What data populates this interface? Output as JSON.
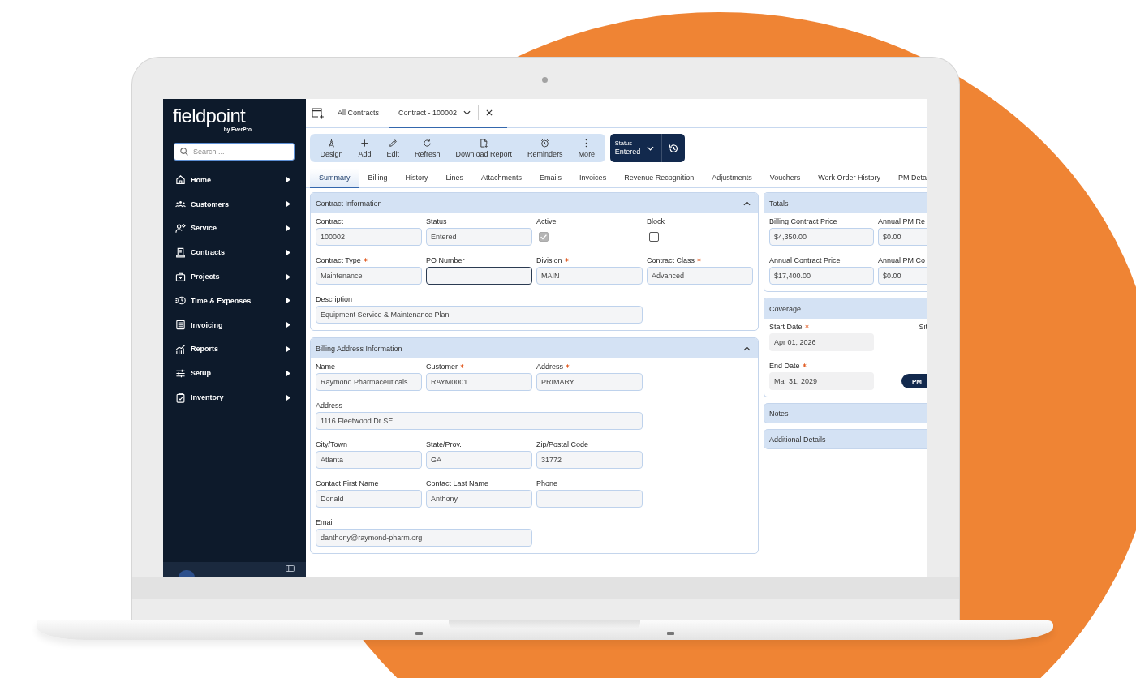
{
  "sidebar": {
    "logo": "fieldpoint",
    "byline": "by EverPro",
    "search": {
      "placeholder": "Search ..."
    },
    "items": [
      {
        "label": "Home"
      },
      {
        "label": "Customers"
      },
      {
        "label": "Service"
      },
      {
        "label": "Contracts"
      },
      {
        "label": "Projects"
      },
      {
        "label": "Time & Expenses"
      },
      {
        "label": "Invoicing"
      },
      {
        "label": "Reports"
      },
      {
        "label": "Setup"
      },
      {
        "label": "Inventory"
      }
    ]
  },
  "page_tabs": [
    {
      "label": "All Contracts",
      "selected": false
    },
    {
      "label": "Contract - 100002",
      "selected": true
    }
  ],
  "toolbar": {
    "actions": [
      {
        "label": "Design"
      },
      {
        "label": "Add"
      },
      {
        "label": "Edit"
      },
      {
        "label": "Refresh"
      },
      {
        "label": "Download Report"
      },
      {
        "label": "Reminders"
      },
      {
        "label": "More"
      }
    ],
    "status": {
      "label": "Status",
      "value": "Entered"
    }
  },
  "tabs": [
    {
      "label": "Summary",
      "selected": true
    },
    {
      "label": "Billing",
      "selected": false
    },
    {
      "label": "History",
      "selected": false
    },
    {
      "label": "Lines",
      "selected": false
    },
    {
      "label": "Attachments",
      "selected": false
    },
    {
      "label": "Emails",
      "selected": false
    },
    {
      "label": "Invoices",
      "selected": false
    },
    {
      "label": "Revenue Recognition",
      "selected": false
    },
    {
      "label": "Adjustments",
      "selected": false
    },
    {
      "label": "Vouchers",
      "selected": false
    },
    {
      "label": "Work Order History",
      "selected": false
    },
    {
      "label": "PM Deta",
      "selected": false
    }
  ],
  "main_sections": [
    {
      "title": "Contract Information",
      "expanded": true,
      "rows": [
        [
          {
            "kind": "text",
            "label": "Contract",
            "value": "100002",
            "required": false,
            "focused": false
          },
          {
            "kind": "text",
            "label": "Status",
            "value": "Entered",
            "required": false,
            "focused": false
          },
          {
            "kind": "checkbox",
            "label": "Active",
            "required": false,
            "checked": true,
            "disabled": true
          },
          {
            "kind": "checkbox",
            "label": "Block",
            "required": false,
            "checked": false,
            "disabled": false
          }
        ],
        [
          {
            "kind": "text",
            "label": "Contract Type",
            "value": "Maintenance",
            "required": true,
            "focused": false
          },
          {
            "kind": "text",
            "label": "PO Number",
            "required": false,
            "focused": true
          },
          {
            "kind": "text",
            "label": "Division",
            "value": "MAIN",
            "required": true,
            "focused": false
          },
          {
            "kind": "text",
            "label": "Contract Class",
            "value": "Advanced",
            "required": true,
            "focused": false
          }
        ],
        [
          {
            "kind": "text",
            "label": "Description",
            "value": "Equipment Service & Maintenance Plan",
            "required": false,
            "focused": false
          }
        ]
      ]
    },
    {
      "title": "Billing Address Information",
      "expanded": true,
      "rows": [
        [
          {
            "kind": "text",
            "label": "Name",
            "value": "Raymond Pharmaceuticals",
            "required": false,
            "focused": false
          },
          {
            "kind": "text",
            "label": "Customer",
            "value": "RAYM0001",
            "required": true,
            "focused": false
          },
          {
            "kind": "text",
            "label": "Address",
            "value": "PRIMARY",
            "required": true,
            "focused": false
          }
        ],
        [
          {
            "kind": "text",
            "label": "Address",
            "value": "1116 Fleetwood Dr SE",
            "required": false,
            "focused": false
          }
        ],
        [
          {
            "kind": "text",
            "label": "City/Town",
            "value": "Atlanta",
            "required": false,
            "focused": false
          },
          {
            "kind": "text",
            "label": "State/Prov.",
            "value": "GA",
            "required": false,
            "focused": false
          },
          {
            "kind": "text",
            "label": "Zip/Postal Code",
            "value": "31772",
            "required": false,
            "focused": false
          }
        ],
        [
          {
            "kind": "text",
            "label": "Contact First Name",
            "value": "Donald",
            "required": false,
            "focused": false
          },
          {
            "kind": "text",
            "label": "Contact Last Name",
            "value": "Anthony",
            "required": false,
            "focused": false
          },
          {
            "kind": "text",
            "label": "Phone",
            "required": false,
            "focused": false
          }
        ],
        [
          {
            "kind": "text",
            "label": "Email",
            "value": "danthony@raymond-pharm.org",
            "required": false,
            "focused": false
          }
        ]
      ]
    }
  ],
  "side_sections": [
    {
      "title": "Totals",
      "expanded": true,
      "rows": [
        [
          {
            "kind": "text",
            "label": "Billing Contract Price",
            "value": "$4,350.00",
            "required": false,
            "focused": false
          },
          {
            "kind": "text",
            "label": "Annual PM Re",
            "value": "$0.00",
            "required": false,
            "focused": false
          }
        ],
        [
          {
            "kind": "text",
            "label": "Annual Contract Price",
            "value": "$17,400.00",
            "required": false,
            "focused": false
          },
          {
            "kind": "text",
            "label": "Annual PM Co",
            "value": "$0.00",
            "required": false,
            "focused": false
          }
        ]
      ]
    },
    {
      "title": "Coverage",
      "expanded": true,
      "rows": [
        [
          {
            "kind": "date",
            "label": "Start Date",
            "value": "Apr 01, 2026",
            "required": true
          },
          {
            "kind": "label",
            "label": "Sit",
            "required": false
          }
        ],
        [
          {
            "kind": "date",
            "label": "End Date",
            "value": "Mar 31, 2029",
            "required": true
          },
          {
            "kind": "button",
            "label": "PM"
          }
        ]
      ]
    },
    {
      "title": "Notes",
      "expanded": false
    },
    {
      "title": "Additional Details",
      "expanded": false
    }
  ]
}
